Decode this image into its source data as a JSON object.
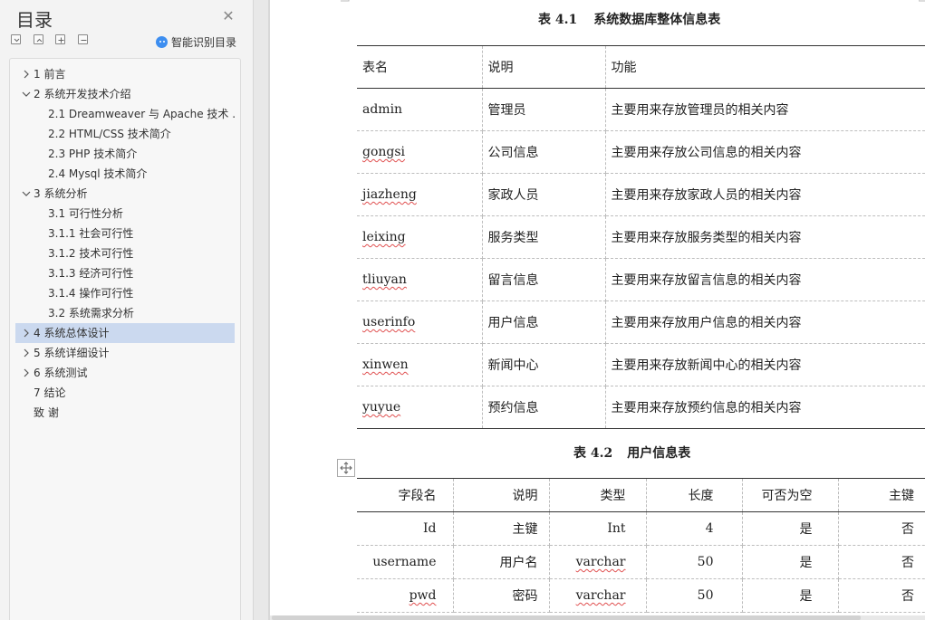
{
  "sidebar": {
    "title": "目录",
    "smart_toc_label": "智能识别目录",
    "items": [
      {
        "label": "1  前言",
        "level": 0,
        "chevron": "right",
        "active": false
      },
      {
        "label": "2 系统开发技术介绍",
        "level": 0,
        "chevron": "down",
        "active": false
      },
      {
        "label": "2.1 Dreamweaver 与 Apache 技术 ...",
        "level": 1,
        "chevron": "",
        "active": false
      },
      {
        "label": "2.2 HTML/CSS 技术简介",
        "level": 1,
        "chevron": "",
        "active": false
      },
      {
        "label": "2.3 PHP 技术简介",
        "level": 1,
        "chevron": "",
        "active": false
      },
      {
        "label": "2.4 Mysql 技术简介",
        "level": 1,
        "chevron": "",
        "active": false
      },
      {
        "label": "3  系统分析",
        "level": 0,
        "chevron": "down",
        "active": false
      },
      {
        "label": "3.1 可行性分析",
        "level": 1,
        "chevron": "",
        "active": false
      },
      {
        "label": "3.1.1  社会可行性",
        "level": 1,
        "chevron": "",
        "active": false
      },
      {
        "label": "3.1.2  技术可行性",
        "level": 1,
        "chevron": "",
        "active": false
      },
      {
        "label": "3.1.3  经济可行性",
        "level": 1,
        "chevron": "",
        "active": false
      },
      {
        "label": "3.1.4  操作可行性",
        "level": 1,
        "chevron": "",
        "active": false
      },
      {
        "label": "3.2 系统需求分析",
        "level": 1,
        "chevron": "",
        "active": false
      },
      {
        "label": "4  系统总体设计",
        "level": 0,
        "chevron": "right",
        "active": true
      },
      {
        "label": "5  系统详细设计",
        "level": 0,
        "chevron": "right",
        "active": false
      },
      {
        "label": "6  系统测试",
        "level": 0,
        "chevron": "right",
        "active": false
      },
      {
        "label": "7 结论",
        "level": 0,
        "chevron": "",
        "active": false
      },
      {
        "label": "致    谢",
        "level": 0,
        "chevron": "",
        "active": false
      }
    ]
  },
  "document": {
    "table1": {
      "caption_num": "表 4.1",
      "caption_text": "系统数据库整体信息表",
      "headers": [
        "表名",
        "说明",
        "功能"
      ],
      "rows": [
        [
          "admin",
          "管理员",
          "主要用来存放管理员的相关内容"
        ],
        [
          "gongsi",
          "公司信息",
          "主要用来存放公司信息的相关内容"
        ],
        [
          "jiazheng",
          "家政人员",
          "主要用来存放家政人员的相关内容"
        ],
        [
          "leixing",
          "服务类型",
          "主要用来存放服务类型的相关内容"
        ],
        [
          "tliuyan",
          "留言信息",
          "主要用来存放留言信息的相关内容"
        ],
        [
          "userinfo",
          "用户信息",
          "主要用来存放用户信息的相关内容"
        ],
        [
          "xinwen",
          "新闻中心",
          "主要用来存放新闻中心的相关内容"
        ],
        [
          "yuyue",
          "预约信息",
          "主要用来存放预约信息的相关内容"
        ]
      ]
    },
    "table2": {
      "caption_num": "表 4.2",
      "caption_text": "用户信息表",
      "headers": [
        "字段名",
        "说明",
        "类型",
        "长度",
        "可否为空",
        "主键"
      ],
      "rows": [
        [
          "Id",
          "主键",
          "Int",
          "4",
          "是",
          "否"
        ],
        [
          "username",
          "用户名",
          "varchar",
          "50",
          "是",
          "否"
        ],
        [
          "pwd",
          "密码",
          "varchar",
          "50",
          "是",
          "否"
        ]
      ]
    }
  }
}
